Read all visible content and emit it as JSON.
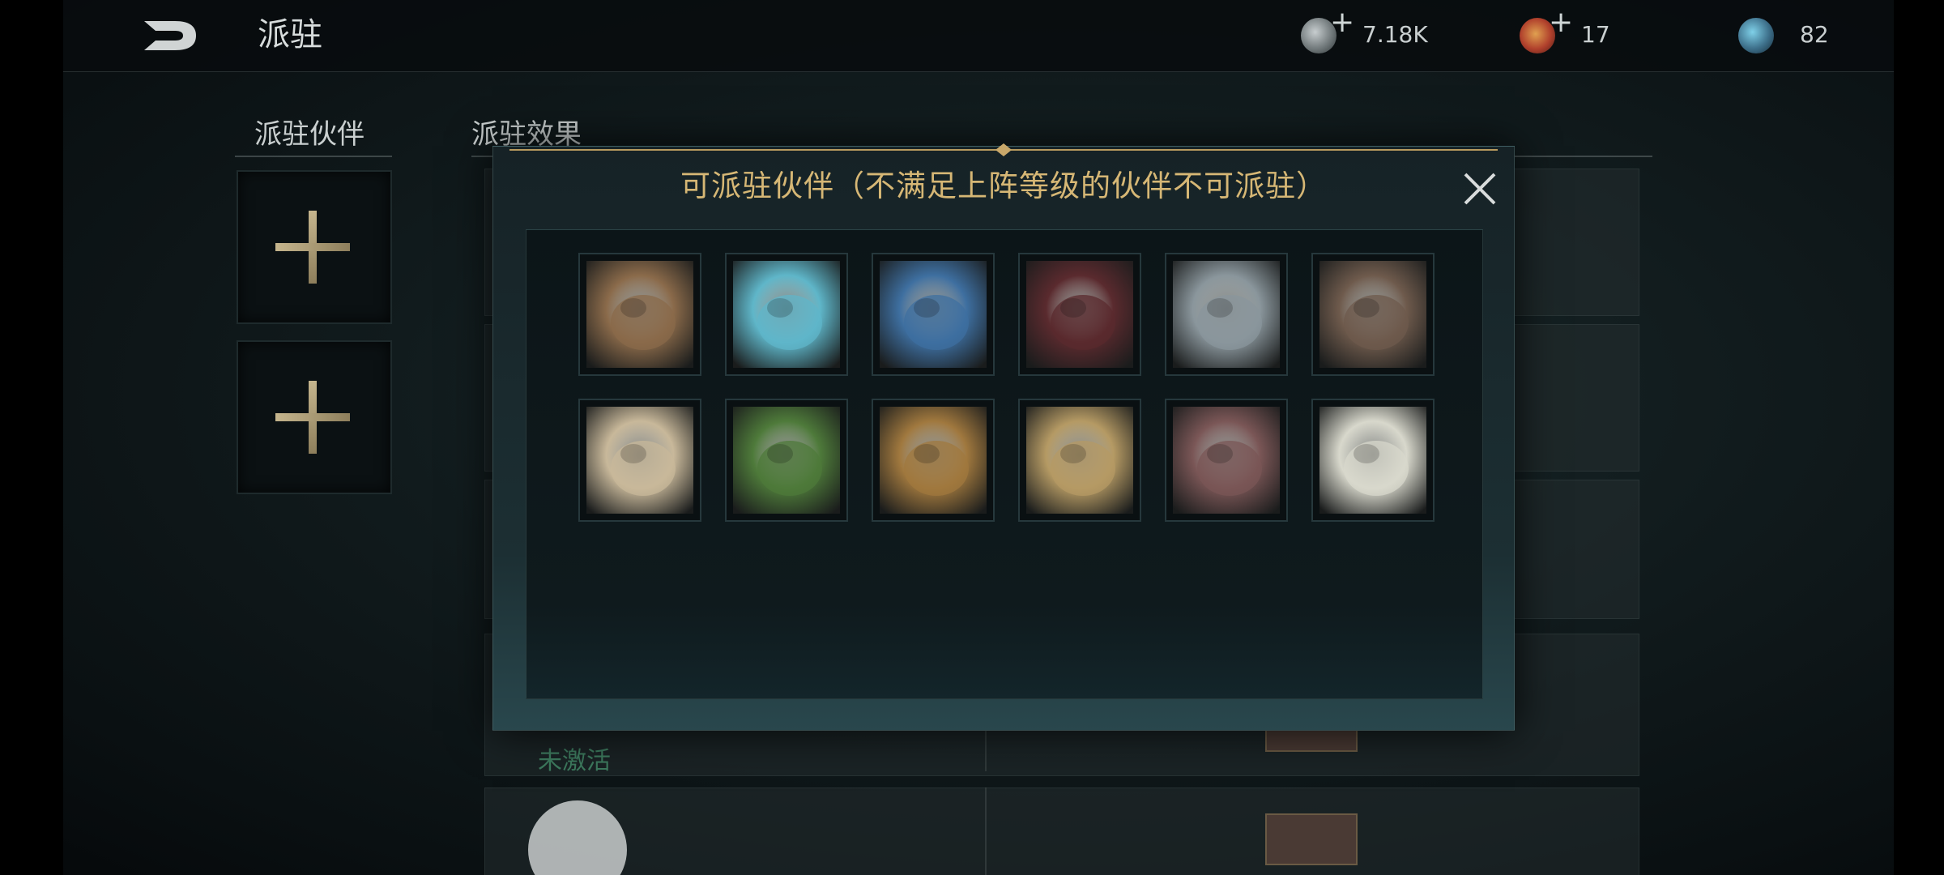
{
  "header": {
    "title": "派驻",
    "back_icon": "back-arrow-icon"
  },
  "currencies": [
    {
      "name": "silver-coin-icon",
      "value": "7.18K",
      "has_plus": true,
      "color": "#8c9496"
    },
    {
      "name": "red-gem-icon",
      "value": "17",
      "has_plus": true,
      "color": "#b0402c"
    },
    {
      "name": "blue-orb-icon",
      "value": "82",
      "has_plus": false,
      "color": "#3d6f8a"
    }
  ],
  "left_panel": {
    "heading": "派驻伙伴",
    "slots": [
      "add-slot",
      "add-slot"
    ]
  },
  "effects_panel": {
    "heading": "派驻效果",
    "inactive_label": "未激活"
  },
  "modal": {
    "title": "可派驻伙伴（不满足上阵等级的伙伴不可派驻）",
    "close_icon": "close-icon",
    "partners": [
      {
        "name": "goat-partner",
        "color": "#8a6a4a"
      },
      {
        "name": "ice-spirit-partner",
        "color": "#5fb6c9"
      },
      {
        "name": "ice-golem-partner",
        "color": "#3e6fa0"
      },
      {
        "name": "dark-knight-partner",
        "color": "#5a2a2e"
      },
      {
        "name": "wolf-partner",
        "color": "#8a969c"
      },
      {
        "name": "rock-beast-partner",
        "color": "#6e5a4c"
      },
      {
        "name": "eagle-partner",
        "color": "#c8b89a"
      },
      {
        "name": "forest-spirit-partner",
        "color": "#4e7a3a"
      },
      {
        "name": "hyena-partner",
        "color": "#a0783e"
      },
      {
        "name": "deer-partner",
        "color": "#b59a64"
      },
      {
        "name": "tentacle-beast-partner",
        "color": "#7a5656"
      },
      {
        "name": "sheep-partner",
        "color": "#d8d8cc"
      }
    ]
  },
  "colors": {
    "accent_gold": "#d6b775",
    "inactive_green": "#3d7a5e"
  }
}
